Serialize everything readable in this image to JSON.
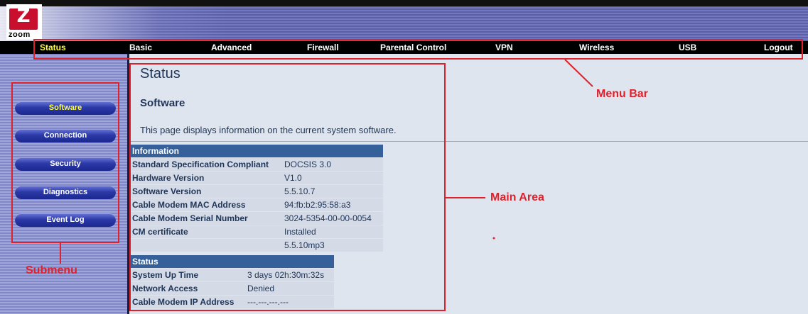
{
  "logo": {
    "text": "zoom"
  },
  "menu": [
    "Status",
    "Basic",
    "Advanced",
    "Firewall",
    "Parental Control",
    "VPN",
    "Wireless",
    "USB",
    "Logout"
  ],
  "submenu": [
    "Software",
    "Connection",
    "Security",
    "Diagnostics",
    "Event Log"
  ],
  "page": {
    "title": "Status",
    "subtitle": "Software",
    "description": "This page displays information on the current system software."
  },
  "information": {
    "header": "Information",
    "rows": [
      {
        "label": "Standard Specification Compliant",
        "value": "DOCSIS 3.0"
      },
      {
        "label": "Hardware Version",
        "value": "V1.0"
      },
      {
        "label": "Software Version",
        "value": "5.5.10.7"
      },
      {
        "label": "Cable Modem MAC Address",
        "value": "94:fb:b2:95:58:a3"
      },
      {
        "label": "Cable Modem Serial Number",
        "value": "3024-5354-00-00-0054"
      },
      {
        "label": "CM certificate",
        "value": "Installed"
      },
      {
        "label": "",
        "value": "5.5.10mp3"
      }
    ]
  },
  "status": {
    "header": "Status",
    "rows": [
      {
        "label": "System Up Time",
        "value": "3 days 02h:30m:32s"
      },
      {
        "label": "Network Access",
        "value": "Denied"
      },
      {
        "label": "Cable Modem IP Address",
        "value": "---.---.---.---"
      }
    ]
  },
  "annotations": {
    "menu_bar": "Menu Bar",
    "main_area": "Main Area",
    "submenu": "Submenu",
    "color": "#e0202a"
  }
}
